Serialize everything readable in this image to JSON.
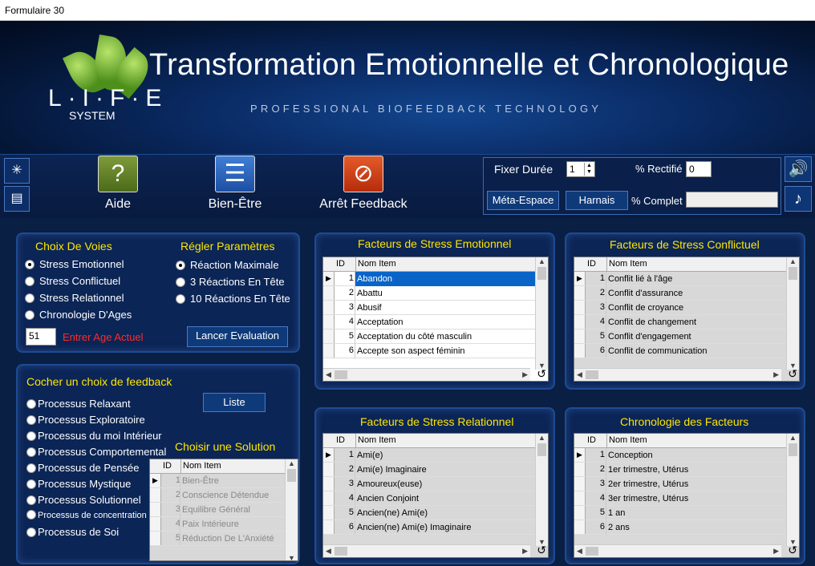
{
  "window": {
    "title": "Formulaire 30"
  },
  "header": {
    "brand_letters": "L·I·F·E",
    "brand_system": "SYSTEM",
    "title": "Transformation Emotionnelle et Chronologique",
    "tagline": "PROFESSIONAL BIOFEEDBACK TECHNOLOGY"
  },
  "toolbar": {
    "aide_label": "Aide",
    "bienetre_label": "Bien-Être",
    "arret_label": "Arrêt Feedback",
    "fixer_duree_label": "Fixer Durée",
    "fixer_duree_value": "1",
    "rectifie_label": "% Rectifié",
    "rectifie_value": "0",
    "meta_espace_label": "Méta-Espace",
    "harnais_label": "Harnais",
    "complet_label": "% Complet",
    "complet_value": ""
  },
  "voies": {
    "title": "Choix De Voies",
    "options": [
      "Stress Emotionnel",
      "Stress Conflictuel",
      "Stress Relationnel",
      "Chronologie D'Ages"
    ],
    "selected": "Stress Emotionnel",
    "age_value": "51",
    "age_label": "Entrer Age Actuel"
  },
  "params": {
    "title": "Régler Paramètres",
    "options": [
      "Réaction Maximale",
      "3 Réactions En Tête",
      "10 Réactions En Tête"
    ],
    "selected": "Réaction Maximale",
    "launch_label": "Lancer Evaluation"
  },
  "feedback": {
    "title": "Cocher un choix de feedback",
    "liste_label": "Liste",
    "options": [
      "Processus Relaxant",
      "Processus Exploratoire",
      "Processus du moi Intérieur",
      "Processus Comportemental",
      "Processus de Pensée",
      "Processus Mystique",
      "Processus Solutionnel",
      "Processus de concentration",
      "Processus de Soi"
    ]
  },
  "solution": {
    "title": "Choisir une Solution",
    "col_id": "ID",
    "col_name": "Nom Item",
    "rows": [
      {
        "id": "1",
        "name": "Bien-Être"
      },
      {
        "id": "2",
        "name": "Conscience Détendue"
      },
      {
        "id": "3",
        "name": "Equilibre Général"
      },
      {
        "id": "4",
        "name": "Paix Intérieure"
      },
      {
        "id": "5",
        "name": "Réduction De L'Anxiété"
      }
    ]
  },
  "emotionnel": {
    "title": "Facteurs de Stress Emotionnel",
    "col_id": "ID",
    "col_name": "Nom Item",
    "rows": [
      {
        "id": "1",
        "name": "Abandon"
      },
      {
        "id": "2",
        "name": "Abattu"
      },
      {
        "id": "3",
        "name": "Abusif"
      },
      {
        "id": "4",
        "name": "Acceptation"
      },
      {
        "id": "5",
        "name": "Acceptation du côté masculin"
      },
      {
        "id": "6",
        "name": "Accepte son aspect féminin"
      }
    ]
  },
  "conflictuel": {
    "title": "Facteurs de Stress Conflictuel",
    "col_id": "ID",
    "col_name": "Nom Item",
    "rows": [
      {
        "id": "1",
        "name": "Conflit lié à l'âge"
      },
      {
        "id": "2",
        "name": "Conflit d'assurance"
      },
      {
        "id": "3",
        "name": "Conflit de croyance"
      },
      {
        "id": "4",
        "name": "Conflit de changement"
      },
      {
        "id": "5",
        "name": "Conflit d'engagement"
      },
      {
        "id": "6",
        "name": "Conflit de communication"
      }
    ]
  },
  "relationnel": {
    "title": "Facteurs de Stress Relationnel",
    "col_id": "ID",
    "col_name": "Nom Item",
    "rows": [
      {
        "id": "1",
        "name": "Ami(e)"
      },
      {
        "id": "2",
        "name": "Ami(e) Imaginaire"
      },
      {
        "id": "3",
        "name": "Amoureux(euse)"
      },
      {
        "id": "4",
        "name": "Ancien Conjoint"
      },
      {
        "id": "5",
        "name": "Ancien(ne) Ami(e)"
      },
      {
        "id": "6",
        "name": "Ancien(ne) Ami(e) Imaginaire"
      }
    ]
  },
  "chronologie": {
    "title": "Chronologie des Facteurs",
    "col_id": "ID",
    "col_name": "Nom Item",
    "rows": [
      {
        "id": "1",
        "name": "Conception"
      },
      {
        "id": "2",
        "name": "1er trimestre, Utérus"
      },
      {
        "id": "3",
        "name": "2er trimestre, Utérus"
      },
      {
        "id": "4",
        "name": "3er trimestre, Utérus"
      },
      {
        "id": "5",
        "name": "1 an"
      },
      {
        "id": "6",
        "name": "2 ans"
      }
    ]
  },
  "colors": {
    "accent_title": "#ffe600",
    "panel_bg": "#0b2556",
    "age_label": "#ff2a2a",
    "selected_row": "#0a64c8"
  }
}
